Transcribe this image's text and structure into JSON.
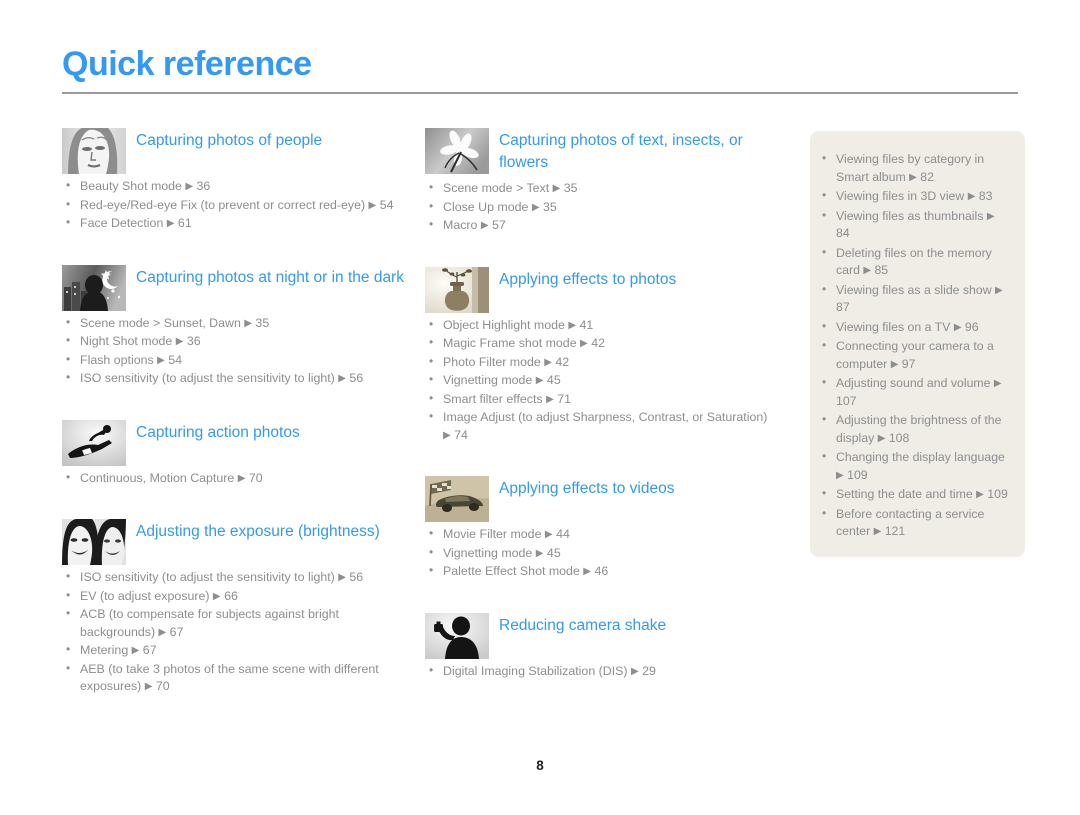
{
  "header": {
    "title": "Quick reference",
    "accent_color": "#3399f3",
    "rule_color": "#9a9a9a"
  },
  "footer": {
    "page_number": "8"
  },
  "arrow_glyph": "▶",
  "columns": {
    "left": [
      {
        "thumb": "portrait-woman-thumbnail",
        "title": "Capturing photos of people",
        "items": [
          "Beauty Shot mode ▶ 36",
          "Red-eye/Red-eye Fix (to prevent or correct red-eye) ▶ 54",
          "Face Detection ▶ 61"
        ]
      },
      {
        "thumb": "night-scene-thumbnail",
        "title": "Capturing photos at night or in the dark",
        "items": [
          "Scene mode > Sunset, Dawn ▶ 35",
          "Night Shot mode ▶ 36",
          "Flash options ▶ 54",
          "ISO sensitivity (to adjust the sensitivity to light) ▶ 56"
        ]
      },
      {
        "thumb": "snowboarder-thumbnail",
        "title": "Capturing action photos",
        "items": [
          "Continuous, Motion Capture ▶ 70"
        ]
      },
      {
        "thumb": "two-faces-thumbnail",
        "title": "Adjusting the exposure (brightness)",
        "items": [
          "ISO sensitivity (to adjust the sensitivity to light) ▶ 56",
          "EV (to adjust exposure) ▶ 66",
          "ACB (to compensate for subjects against bright backgrounds) ▶ 67",
          "Metering ▶ 67",
          "AEB (to take 3 photos of the same scene with different exposures) ▶ 70"
        ]
      }
    ],
    "middle": [
      {
        "thumb": "flower-macro-thumbnail",
        "title": "Capturing  photos of text, insects, or flowers",
        "items": [
          "Scene mode > Text ▶ 35",
          "Close Up mode ▶ 35",
          "Macro ▶ 57"
        ]
      },
      {
        "thumb": "vase-still-life-thumbnail",
        "title": "Applying effects to photos",
        "items": [
          "Object Highlight mode ▶ 41",
          "Magic Frame shot mode ▶ 42",
          "Photo Filter mode ▶ 42",
          "Vignetting mode ▶ 45",
          "Smart filter effects ▶ 71",
          "Image Adjust (to adjust Sharpness, Contrast, or Saturation) ▶ 74"
        ]
      },
      {
        "thumb": "race-car-thumbnail",
        "title": "Applying effects to videos",
        "items": [
          "Movie Filter mode ▶ 44",
          "Vignetting mode ▶ 45",
          "Palette Effect Shot mode ▶ 46"
        ]
      },
      {
        "thumb": "person-holding-camera-thumbnail",
        "title": "Reducing camera shake",
        "items": [
          "Digital Imaging Stabilization (DIS) ▶ 29"
        ]
      }
    ]
  },
  "sidebar": {
    "background_color": "#f0ede6",
    "items": [
      "Viewing files by category in Smart album ▶ 82",
      "Viewing files in 3D view ▶ 83",
      "Viewing files as thumbnails ▶ 84",
      "Deleting files on the memory card ▶ 85",
      "Viewing files as a slide show ▶ 87",
      "Viewing files on a TV ▶ 96",
      "Connecting your camera to a computer ▶ 97",
      "Adjusting sound and volume ▶ 107",
      "Adjusting the brightness of the display ▶ 108",
      "Changing the display language ▶ 109",
      "Setting the date and time ▶ 109",
      "Before contacting a service center ▶ 121"
    ]
  }
}
